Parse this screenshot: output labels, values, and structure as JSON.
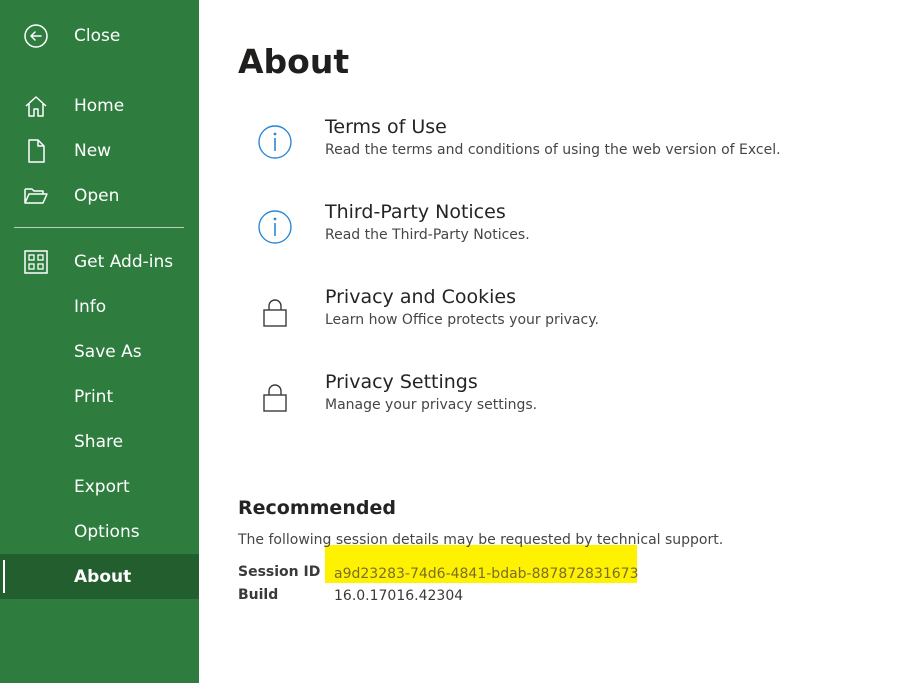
{
  "sidebar": {
    "close": {
      "label": "Close",
      "icon": "back-arrow-icon"
    },
    "items": [
      {
        "label": "Home",
        "icon": "home-icon"
      },
      {
        "label": "New",
        "icon": "new-document-icon"
      },
      {
        "label": "Open",
        "icon": "folder-open-icon"
      },
      {
        "label": "Get Add-ins",
        "icon": "add-ins-grid-icon"
      },
      {
        "label": "Info"
      },
      {
        "label": "Save As"
      },
      {
        "label": "Print"
      },
      {
        "label": "Share"
      },
      {
        "label": "Export"
      },
      {
        "label": "Options"
      },
      {
        "label": "About",
        "selected": true
      }
    ]
  },
  "main": {
    "title": "About",
    "items": [
      {
        "title": "Terms of Use",
        "description": "Read the terms and conditions of using the web version of Excel.",
        "icon": "info-icon"
      },
      {
        "title": "Third-Party Notices",
        "description": "Read the Third-Party Notices.",
        "icon": "info-icon"
      },
      {
        "title": "Privacy and Cookies",
        "description": "Learn how Office protects your privacy.",
        "icon": "lock-icon"
      },
      {
        "title": "Privacy Settings",
        "description": "Manage your privacy settings.",
        "icon": "lock-icon"
      }
    ],
    "recommended": {
      "title": "Recommended",
      "description": "The following session details may be requested by technical support.",
      "session_label": "Session ID",
      "session_value": "a9d23283-74d6-4841-bdab-887872831673",
      "build_label": "Build",
      "build_value": "16.0.17016.42304"
    }
  },
  "colors": {
    "sidebar_bg": "#2e7d3e",
    "sidebar_selected_bg": "#225e2e",
    "info_icon": "#2b88d8",
    "highlight": "#fff200"
  }
}
